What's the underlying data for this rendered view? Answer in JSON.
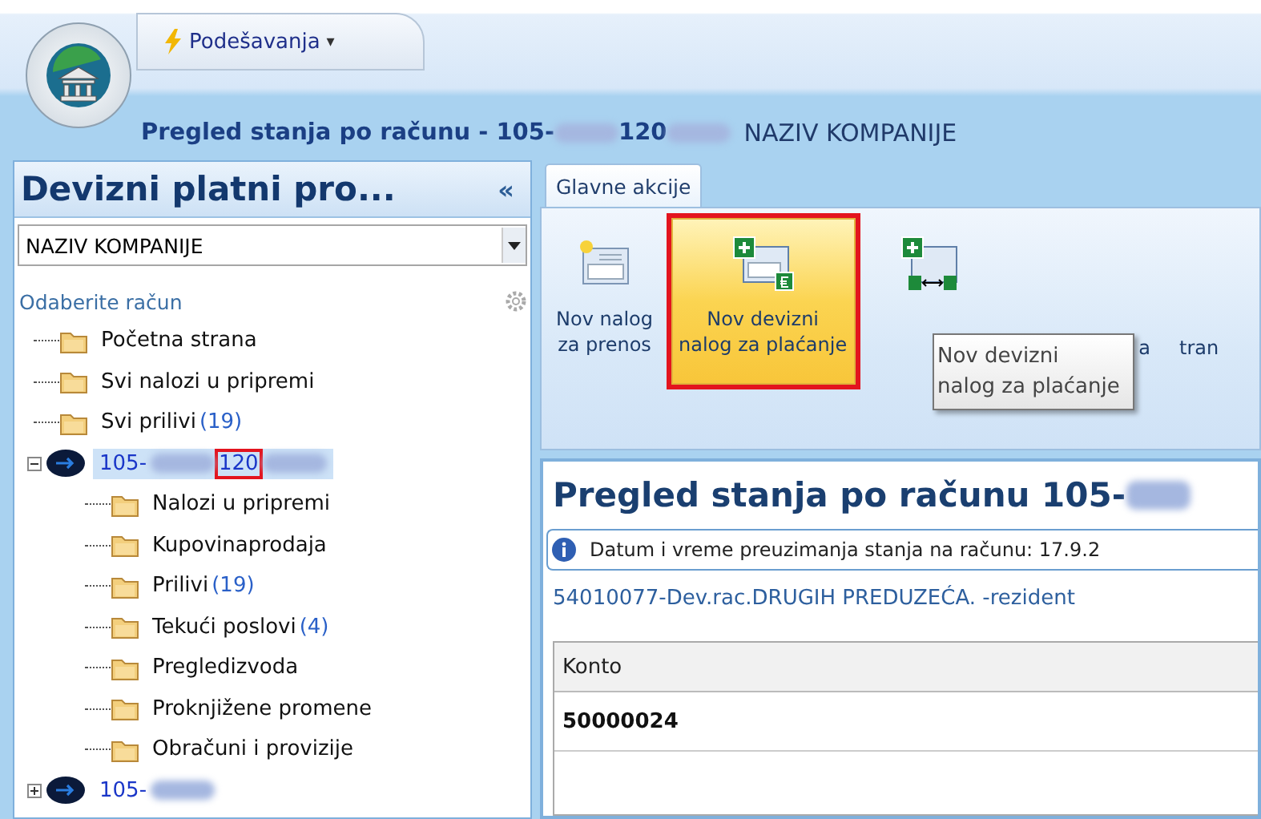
{
  "quick_access": {
    "menu": {
      "label": "Podešavanja",
      "caret": "▾"
    }
  },
  "title_bar": {
    "parts": [
      {
        "kind": "text",
        "text": "Pregled stanja po računu - 105-"
      },
      {
        "kind": "blur"
      },
      {
        "kind": "text",
        "text": "120"
      },
      {
        "kind": "blur"
      },
      {
        "kind": "plain",
        "text": "NAZIV KOMPANIJE"
      }
    ]
  },
  "sidebar": {
    "title": "Devizni platni pro...",
    "collapse": "«",
    "company_select": {
      "value": "NAZIV KOMPANIJE"
    },
    "account_label": "Odaberite račun",
    "tree": [
      {
        "kind": "folder",
        "label": "Početna strana",
        "selected": false
      },
      {
        "kind": "folder",
        "label": "Svi nalozi u pripremi",
        "selected": false
      },
      {
        "kind": "folder",
        "label": "Svi prilivi",
        "count": "(19)",
        "selected": false
      },
      {
        "kind": "account",
        "expanded": true,
        "selected": true,
        "parts": [
          {
            "kind": "text",
            "text": "105-"
          },
          {
            "kind": "blur"
          },
          {
            "kind": "text",
            "text": "120",
            "highlighted": true
          },
          {
            "kind": "blur"
          }
        ],
        "children": [
          {
            "kind": "folder",
            "label": "Nalozi u pripremi",
            "selected": false
          },
          {
            "kind": "folder",
            "label": "Kupovinaprodaja",
            "selected": false
          },
          {
            "kind": "folder",
            "label": "Prilivi",
            "count": "(19)",
            "selected": false
          },
          {
            "kind": "folder",
            "label": "Tekući poslovi",
            "count": "(4)",
            "selected": false
          },
          {
            "kind": "folder",
            "label": "Pregledizvoda",
            "selected": false
          },
          {
            "kind": "folder",
            "label": "Proknjižene promene",
            "selected": false
          },
          {
            "kind": "folder",
            "label": "Obračuni i provizije",
            "selected": false
          }
        ]
      },
      {
        "kind": "account",
        "expanded": false,
        "selected": false,
        "parts": [
          {
            "kind": "text",
            "text": "105-"
          },
          {
            "kind": "blur"
          }
        ]
      }
    ]
  },
  "ribbon": {
    "tabs": [
      {
        "label": "Glavne akcije",
        "selected": true
      }
    ],
    "buttons": [
      {
        "lines": [
          "Nov nalog",
          "za prenos"
        ],
        "hovered": false,
        "highlighted": false
      },
      {
        "lines": [
          "Nov devizni",
          "nalog za plaćanje"
        ],
        "hovered": true,
        "highlighted": true
      },
      {
        "fragments": [
          "a",
          "tran"
        ],
        "hovered": false,
        "highlighted": false
      }
    ],
    "tooltip": {
      "lines": [
        "Nov devizni",
        "nalog za plaćanje"
      ]
    }
  },
  "content": {
    "heading": {
      "parts": [
        {
          "kind": "text",
          "text": "Pregled stanja po računu 105-"
        },
        {
          "kind": "blur"
        }
      ]
    },
    "info": "Datum i vreme preuzimanja stanja na računu: 17.9.2",
    "account_line": "54010077-Dev.rac.DRUGIH PREDUZEĆA. -rezident",
    "table": {
      "columns": [
        "Konto"
      ],
      "rows": [
        [
          "50000024"
        ]
      ]
    }
  }
}
